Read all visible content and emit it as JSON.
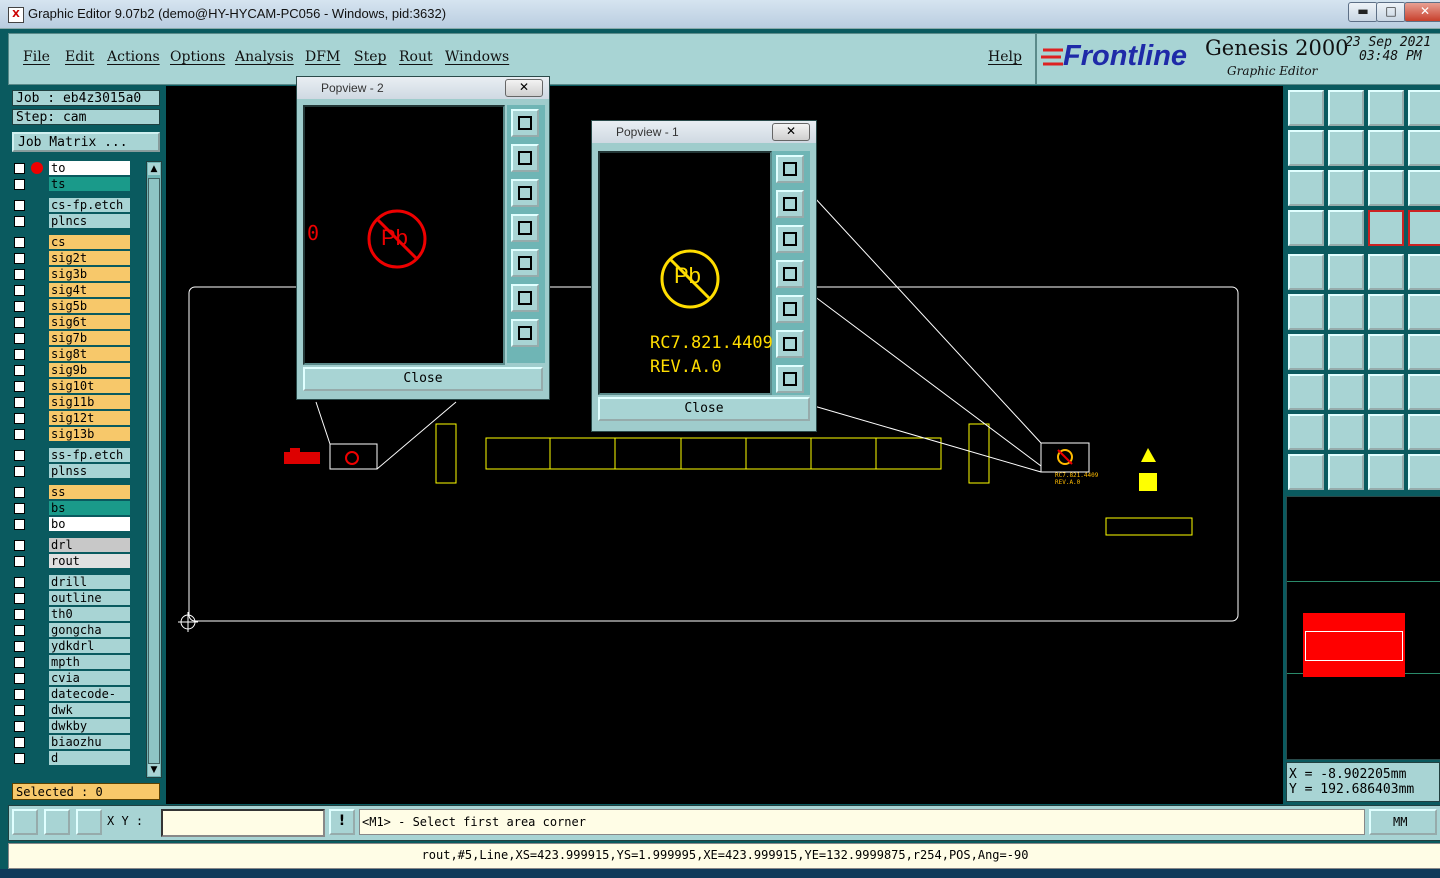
{
  "window": {
    "title": "Graphic Editor 9.07b2 (demo@HY-HYCAM-PC056 - Windows, pid:3632)",
    "app_icon": "X",
    "min_label": "▬",
    "max_label": "□",
    "close_label": "✕"
  },
  "menu": {
    "items": [
      "File",
      "Edit",
      "Actions",
      "Options",
      "Analysis",
      "DFM",
      "Step",
      "Rout",
      "Windows"
    ],
    "help": "Help"
  },
  "brand": {
    "logo": "Frontline",
    "product": "Genesis 2000",
    "subtitle": "Graphic Editor",
    "date": "23  Sep  2021",
    "time": "03:48  PM"
  },
  "job": {
    "job_label": "Job : eb4z3015a0",
    "step_label": "Step: cam",
    "matrix_button": "Job Matrix ..."
  },
  "layers": [
    {
      "name": "to",
      "color": "#ffffff"
    },
    {
      "name": "ts",
      "color": "#1a9a8a"
    },
    {
      "name": "cs-fp.etch",
      "color": "#a8d4d4"
    },
    {
      "name": "plncs",
      "color": "#a8d4d4"
    },
    {
      "name": "cs",
      "color": "#f7c86a"
    },
    {
      "name": "sig2t",
      "color": "#f7c86a"
    },
    {
      "name": "sig3b",
      "color": "#f7c86a"
    },
    {
      "name": "sig4t",
      "color": "#f7c86a"
    },
    {
      "name": "sig5b",
      "color": "#f7c86a"
    },
    {
      "name": "sig6t",
      "color": "#f7c86a"
    },
    {
      "name": "sig7b",
      "color": "#f7c86a"
    },
    {
      "name": "sig8t",
      "color": "#f7c86a"
    },
    {
      "name": "sig9b",
      "color": "#f7c86a"
    },
    {
      "name": "sig10t",
      "color": "#f7c86a"
    },
    {
      "name": "sig11b",
      "color": "#f7c86a"
    },
    {
      "name": "sig12t",
      "color": "#f7c86a"
    },
    {
      "name": "sig13b",
      "color": "#f7c86a"
    },
    {
      "name": "ss-fp.etch",
      "color": "#a8d4d4"
    },
    {
      "name": "plnss",
      "color": "#a8d4d4"
    },
    {
      "name": "ss",
      "color": "#f7c86a"
    },
    {
      "name": "bs",
      "color": "#1a9a8a"
    },
    {
      "name": "bo",
      "color": "#ffffff"
    },
    {
      "name": "drl",
      "color": "#c8c8c8"
    },
    {
      "name": "rout",
      "color": "#e0e0e0"
    },
    {
      "name": "drill",
      "color": "#a8d4d4"
    },
    {
      "name": "outline",
      "color": "#a8d4d4"
    },
    {
      "name": "th0",
      "color": "#a8d4d4"
    },
    {
      "name": "gongcha",
      "color": "#a8d4d4"
    },
    {
      "name": "ydkdrl",
      "color": "#a8d4d4"
    },
    {
      "name": "mpth",
      "color": "#a8d4d4"
    },
    {
      "name": "cvia",
      "color": "#a8d4d4"
    },
    {
      "name": "datecode-to",
      "color": "#a8d4d4"
    },
    {
      "name": "dwk",
      "color": "#a8d4d4"
    },
    {
      "name": "dwkby",
      "color": "#a8d4d4"
    },
    {
      "name": "biaozhu",
      "color": "#a8d4d4"
    },
    {
      "name": "d",
      "color": "#a8d4d4"
    }
  ],
  "selected_label": "Selected : 0",
  "popview2": {
    "title": "Popview - 2",
    "close": "Close",
    "partial_text": "0"
  },
  "popview1": {
    "title": "Popview - 1",
    "close": "Close",
    "line1": "RC7.821.4409",
    "line2": "REV.A.0"
  },
  "pb_symbol": "Pb",
  "board_small_text": "RC7.821.4409",
  "board_small_text2": "REV.A.0",
  "coords": {
    "x": "X = -8.902205mm",
    "y": "Y = 192.686403mm"
  },
  "bottom": {
    "xy_label": "X Y :",
    "xy_value": "",
    "exclaim": "!",
    "message": "<M1> - Select first area corner",
    "units": "MM"
  },
  "status_line": "rout,#5,Line,XS=423.999915,YS=1.999995,XE=423.999915,YE=132.9999875,r254,POS,Ang=-90",
  "colors": {
    "canvas": "#000000",
    "panel": "#a8d4d4",
    "accent_red": "#ff0000",
    "accent_yellow": "#ffd700"
  }
}
